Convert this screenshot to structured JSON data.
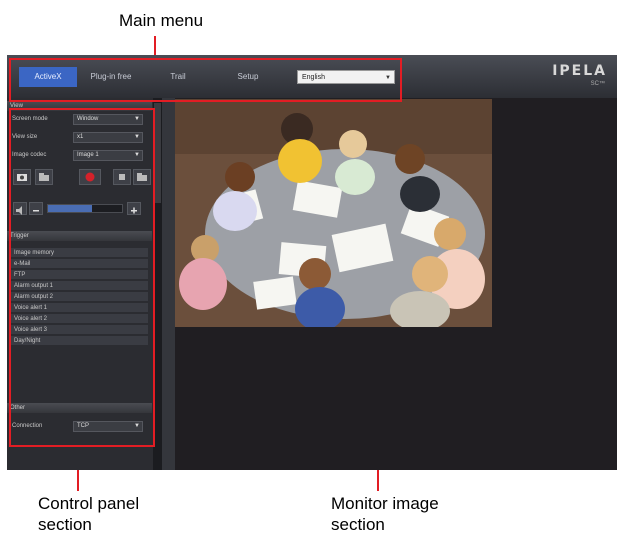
{
  "callouts": {
    "main_menu": "Main menu",
    "control_panel_line1": "Control panel",
    "control_panel_line2": "section",
    "monitor_line1": "Monitor image",
    "monitor_line2": "section"
  },
  "menu": {
    "items": [
      "ActiveX",
      "Plug-in free",
      "Trail",
      "Setup"
    ],
    "active_index": 0,
    "language": "English"
  },
  "logo": {
    "text": "IPELA",
    "sub": "SC™"
  },
  "panel": {
    "view_header": "View",
    "screen_mode_label": "Screen mode",
    "screen_mode_value": "Window",
    "view_size_label": "View size",
    "view_size_value": "x1",
    "image_codec_label": "Image codec",
    "image_codec_value": "Image 1",
    "trigger_header": "Trigger",
    "trigger_items": [
      "Image memory",
      "e-Mail",
      "FTP",
      "Alarm output 1",
      "Alarm output 2",
      "Voice alert 1",
      "Voice alert 2",
      "Voice alert 3",
      "Day/Night"
    ],
    "other_header": "Other",
    "connection_label": "Connection",
    "connection_value": "TCP"
  },
  "colors": {
    "callout_red": "#e21d24",
    "active_menu": "#3b66c4",
    "record_red": "#d4212a"
  }
}
